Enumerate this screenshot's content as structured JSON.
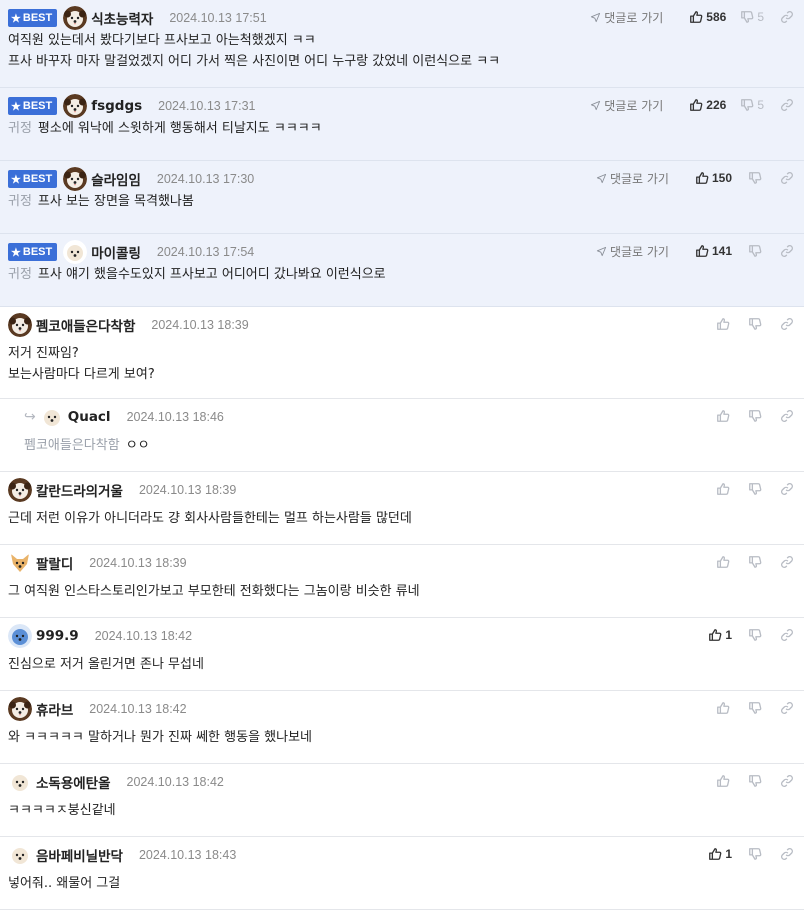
{
  "badge_label": "BEST",
  "goto_label": "댓글로 가기",
  "best": [
    {
      "nick": "식초능력자",
      "date": "2024.10.13 17:51",
      "up": "586",
      "down": "5",
      "avatar": "dog",
      "lines": [
        "여직원 있는데서 봤다기보다 프사보고 아는척했겠지 ㅋㅋ",
        "프사 바꾸자 마자 말걸었겠지 어디 가서 찍은 사진이면 어디 누구랑 갔었네 이런식으로 ㅋㅋ"
      ],
      "mention": ""
    },
    {
      "nick": "fsgdgs",
      "date": "2024.10.13 17:31",
      "up": "226",
      "down": "5",
      "avatar": "dog",
      "lines": [
        "평소에 워낙에 스윗하게 행동해서 티날지도 ㅋㅋㅋㅋ"
      ],
      "mention": "귀정"
    },
    {
      "nick": "슬라임임",
      "date": "2024.10.13 17:30",
      "up": "150",
      "down": "",
      "avatar": "dog",
      "lines": [
        "프사 보는 장면을 목격했나봄"
      ],
      "mention": "귀정"
    },
    {
      "nick": "마이콜링",
      "date": "2024.10.13 17:54",
      "up": "141",
      "down": "",
      "avatar": "puppy",
      "lines": [
        "프사 얘기 했을수도있지 프사보고 어디어디 갔나봐요 이런식으로"
      ],
      "mention": "귀정"
    }
  ],
  "comments": [
    {
      "nick": "펨코애들은다착함",
      "date": "2024.10.13 18:39",
      "up": "",
      "avatar": "dog",
      "reply": false,
      "lines": [
        "저거 진짜임?",
        "보는사람마다 다르게 보여?"
      ],
      "mention": ""
    },
    {
      "nick": "Quacl",
      "date": "2024.10.13 18:46",
      "up": "",
      "avatar": "puppy",
      "reply": true,
      "lines": [
        "ㅇㅇ"
      ],
      "mention": "펨코애들은다착함"
    },
    {
      "nick": "칼란드라의거울",
      "date": "2024.10.13 18:39",
      "up": "",
      "avatar": "dog",
      "reply": false,
      "lines": [
        "근데 저런 이유가 아니더라도 걍 회사사람들한테는 멀프 하는사람들 많던데"
      ],
      "mention": ""
    },
    {
      "nick": "팔랄디",
      "date": "2024.10.13 18:39",
      "up": "",
      "avatar": "fox",
      "reply": false,
      "lines": [
        "그 여직원 인스타스토리인가보고 부모한테 전화했다는 그놈이랑 비슷한 류네"
      ],
      "mention": ""
    },
    {
      "nick": "999.9",
      "date": "2024.10.13 18:42",
      "up": "1",
      "avatar": "blue",
      "reply": false,
      "lines": [
        "진심으로 저거 올린거면 존나 무섭네"
      ],
      "mention": ""
    },
    {
      "nick": "휴라브",
      "date": "2024.10.13 18:42",
      "up": "",
      "avatar": "dog",
      "reply": false,
      "lines": [
        "와 ㅋㅋㅋㅋㅋ 말하거나 뭔가 진짜 쎄한 행동을 했나보네"
      ],
      "mention": ""
    },
    {
      "nick": "소독용에탄올",
      "date": "2024.10.13 18:42",
      "up": "",
      "avatar": "puppy",
      "reply": false,
      "lines": [
        "ㅋㅋㅋㅋㅈ붕신같네"
      ],
      "mention": ""
    },
    {
      "nick": "음바페비닐반닥",
      "date": "2024.10.13 18:43",
      "up": "1",
      "avatar": "puppy",
      "reply": false,
      "lines": [
        "넣어줘.. 왜물어 그걸"
      ],
      "mention": ""
    }
  ]
}
